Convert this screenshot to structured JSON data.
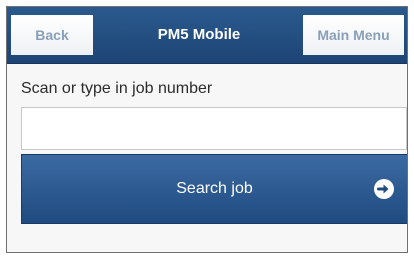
{
  "header": {
    "back_label": "Back",
    "title": "PM5 Mobile",
    "main_menu_label": "Main Menu"
  },
  "form": {
    "job_label": "Scan or type in job number",
    "job_value": "",
    "job_placeholder": "",
    "search_label": "Search job",
    "search_icon": "arrow-right-circle-icon"
  },
  "colors": {
    "header_bg": "#24507f",
    "button_bg": "#2c5a92",
    "header_button_text": "#8aa0b8"
  }
}
